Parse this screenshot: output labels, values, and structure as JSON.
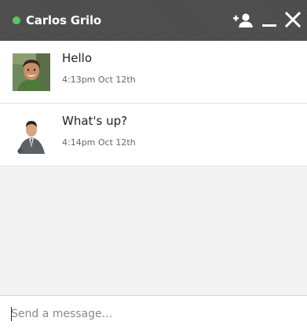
{
  "header": {
    "contact_name": "Carlos Grilo",
    "status_color": "#5bc85b",
    "icons": [
      "add-user-icon",
      "minimize-icon",
      "close-icon"
    ]
  },
  "messages": [
    {
      "text": "Hello",
      "time": "4:13pm Oct 12th",
      "avatar": "avatar-carlos"
    },
    {
      "text": "What's up?",
      "time": "4:14pm Oct 12th",
      "avatar": "avatar-businessman"
    }
  ],
  "composer": {
    "placeholder": "Send a message..."
  }
}
